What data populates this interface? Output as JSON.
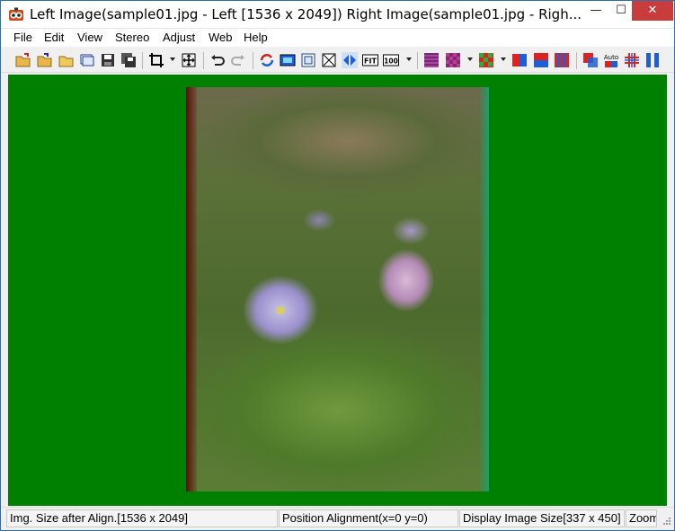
{
  "window": {
    "title": "Left Image(sample01.jpg - Left [1536 x 2049]) Right Image(sample01.jpg - Righ...",
    "minimize_glyph": "—",
    "maximize_glyph": "☐",
    "close_glyph": "✕"
  },
  "menu": {
    "items": [
      {
        "label": "File"
      },
      {
        "label": "Edit"
      },
      {
        "label": "View"
      },
      {
        "label": "Stereo"
      },
      {
        "label": "Adjust"
      },
      {
        "label": "Web"
      },
      {
        "label": "Help"
      }
    ]
  },
  "toolbar": {
    "fit_label": "FIT",
    "zoom100_label": "100",
    "auto_label": "Auto",
    "icons": [
      "open-left-icon",
      "open-right-icon",
      "open-folder-icon",
      "open-stereo-icon",
      "save-icon",
      "save-all-icon",
      "crop-icon",
      "auto-align-icon",
      "undo-icon",
      "redo-icon",
      "swap-icon",
      "fullscreen-icon",
      "window-icon",
      "fit-window-icon",
      "mirror-icon",
      "fit-icon",
      "zoom-100-icon",
      "interlaced-icon",
      "checkerboard-icon",
      "color-anaglyph-icon",
      "side-by-side-icon",
      "over-under-icon",
      "interleave-icon",
      "red-cyan-icon",
      "auto-color-icon",
      "grid-icon",
      "column-icon"
    ]
  },
  "colors": {
    "canvas_bg": "#008000",
    "close_button": "#c83c3c",
    "accent_blue": "#1f5fd6"
  },
  "status": {
    "image_size": "Img. Size after Align.[1536 x 2049]",
    "position": "Position Alignment(x=0 y=0)",
    "display_size": "Display Image Size[337 x 450]",
    "zoom": "Zoom"
  }
}
